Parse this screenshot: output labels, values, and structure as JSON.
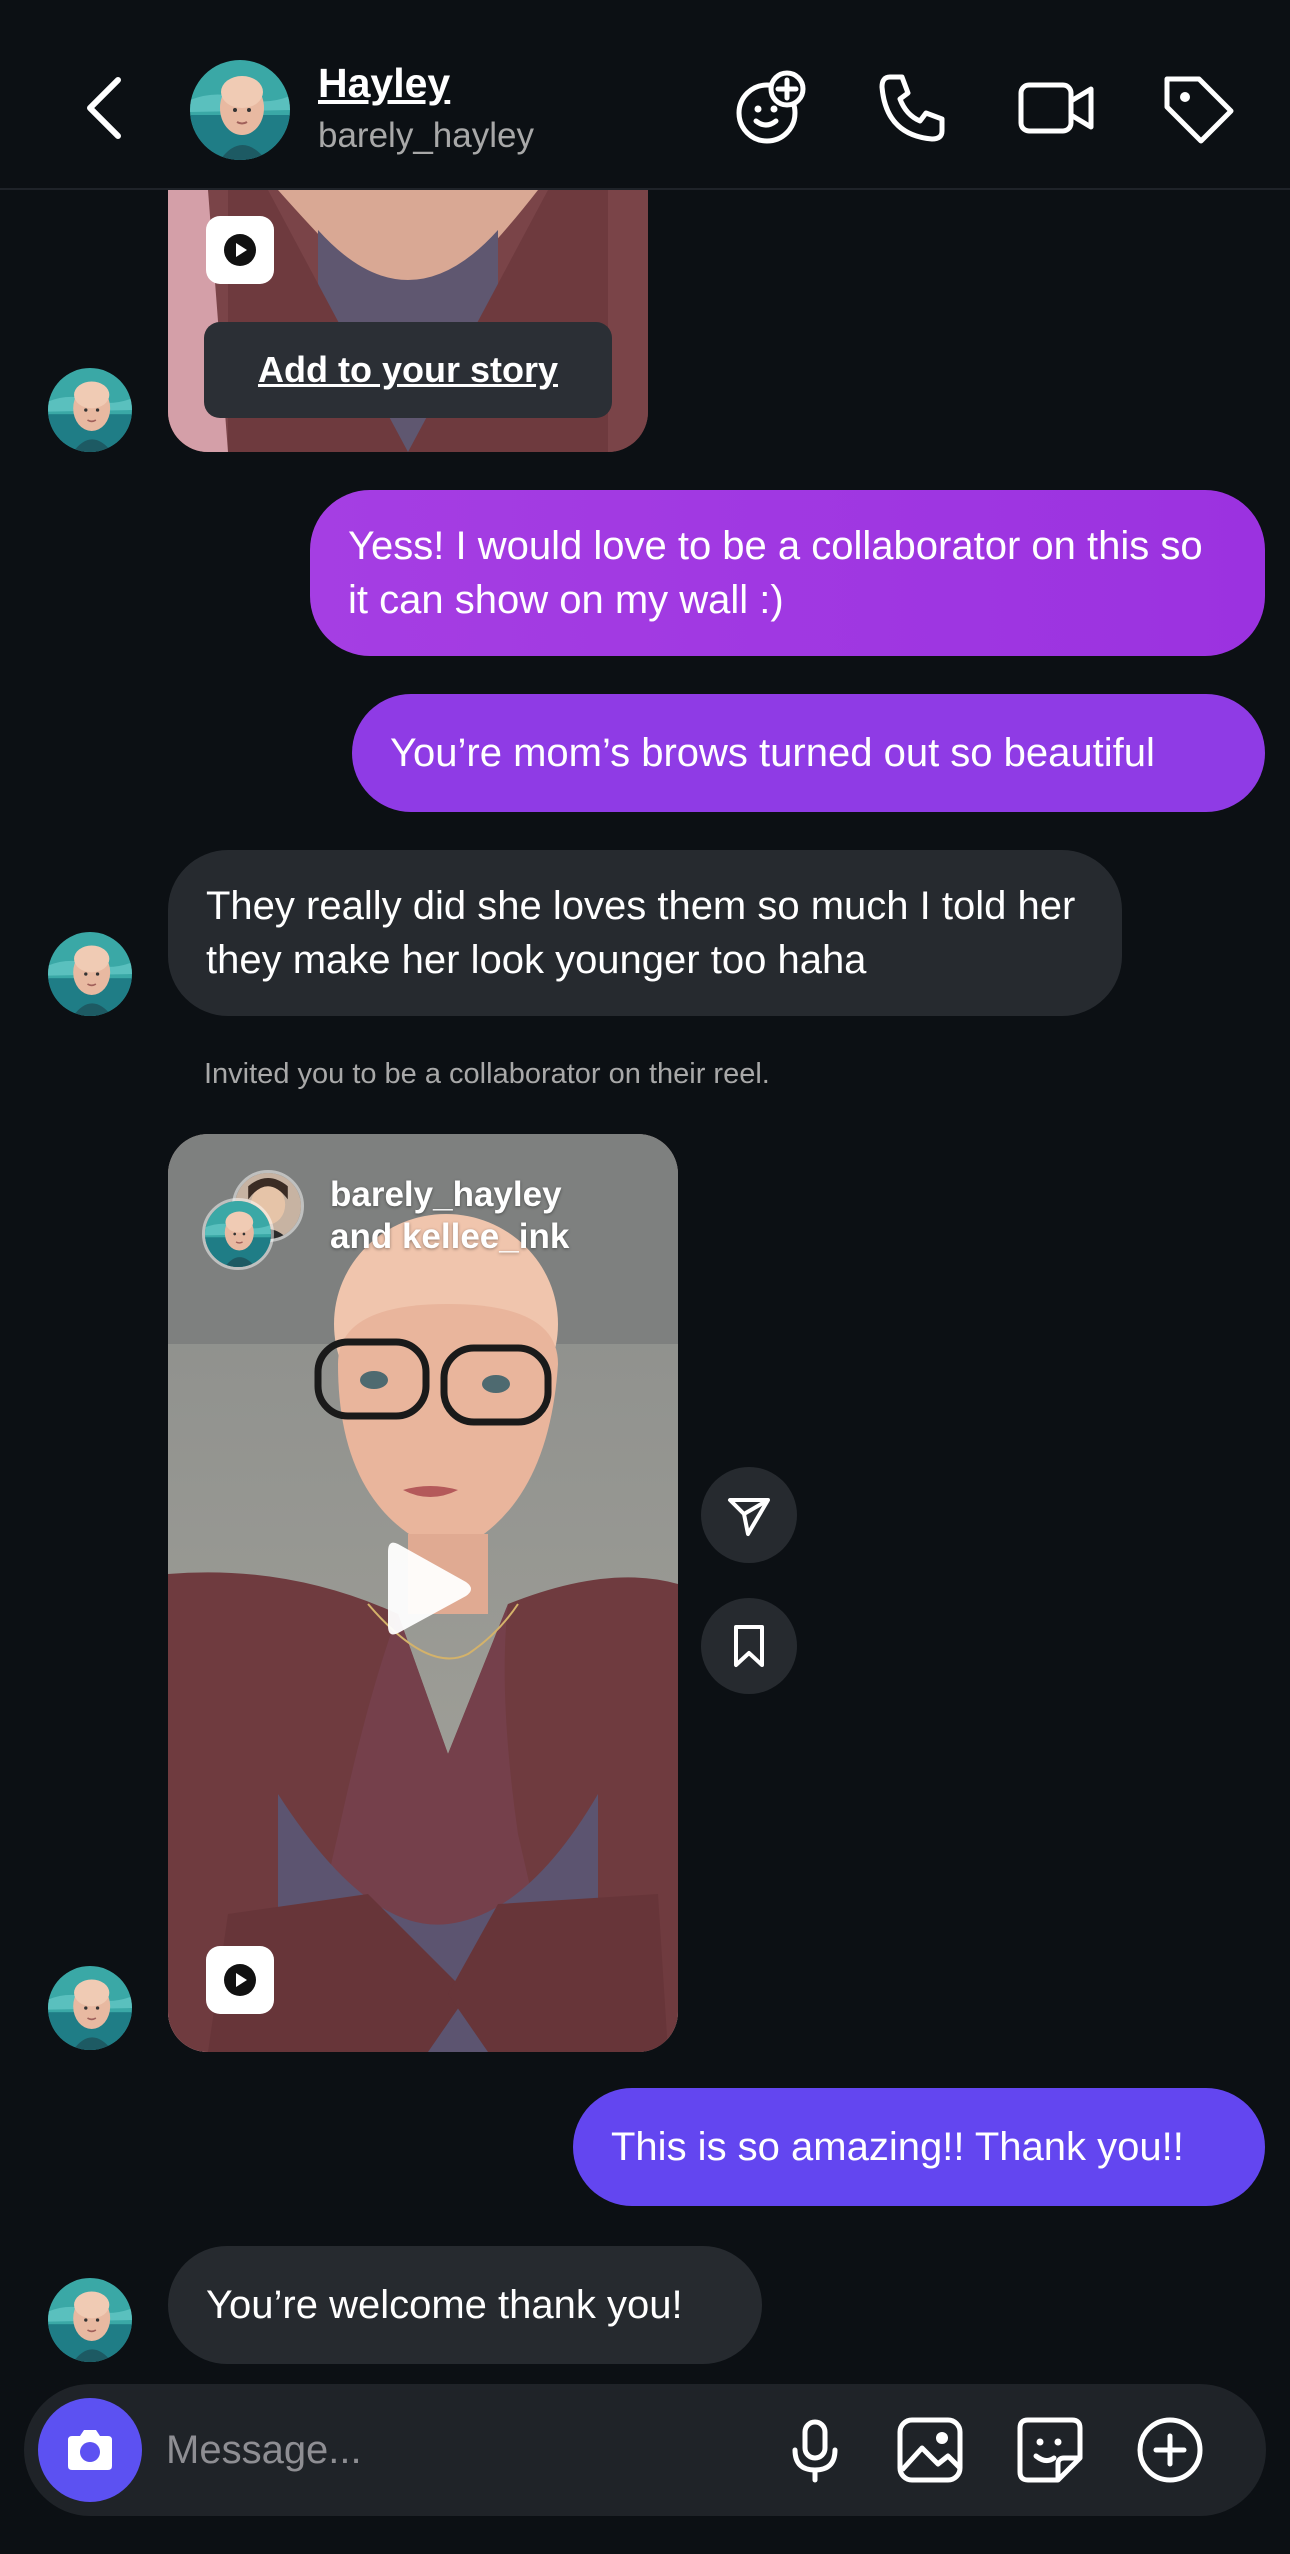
{
  "header": {
    "name": "Hayley",
    "username": "barely_hayley",
    "icons": [
      "back-chevron-icon",
      "add-emoji-icon",
      "phone-icon",
      "video-icon",
      "tag-icon"
    ]
  },
  "top_reel": {
    "add_to_story_label": "Add to your story"
  },
  "messages": {
    "out_1": "Yess! I would love to be a collaborator on this so it can show on my wall :)",
    "out_2": "You’re mom’s brows turned out so beautiful",
    "in_1": "They really did she loves them so much I told her they make her look younger too haha",
    "system_note": "Invited you to be a collaborator on their reel.",
    "out_3": "This is so amazing!! Thank you!!",
    "in_2": "You’re welcome thank you!"
  },
  "reel": {
    "author_1": "barely_hayley",
    "author_2": "and kellee_ink"
  },
  "composer": {
    "placeholder": "Message...",
    "icons": [
      "camera-icon",
      "microphone-icon",
      "gallery-icon",
      "sticker-icon",
      "plus-icon"
    ]
  },
  "colors": {
    "background": "#0c1014",
    "incoming_bubble": "#262a2f",
    "outgoing_gradient": "#a53ee3",
    "outgoing_purple": "#8f3be5",
    "outgoing_blue": "#6346f0",
    "camera_button": "#5c51f2"
  }
}
